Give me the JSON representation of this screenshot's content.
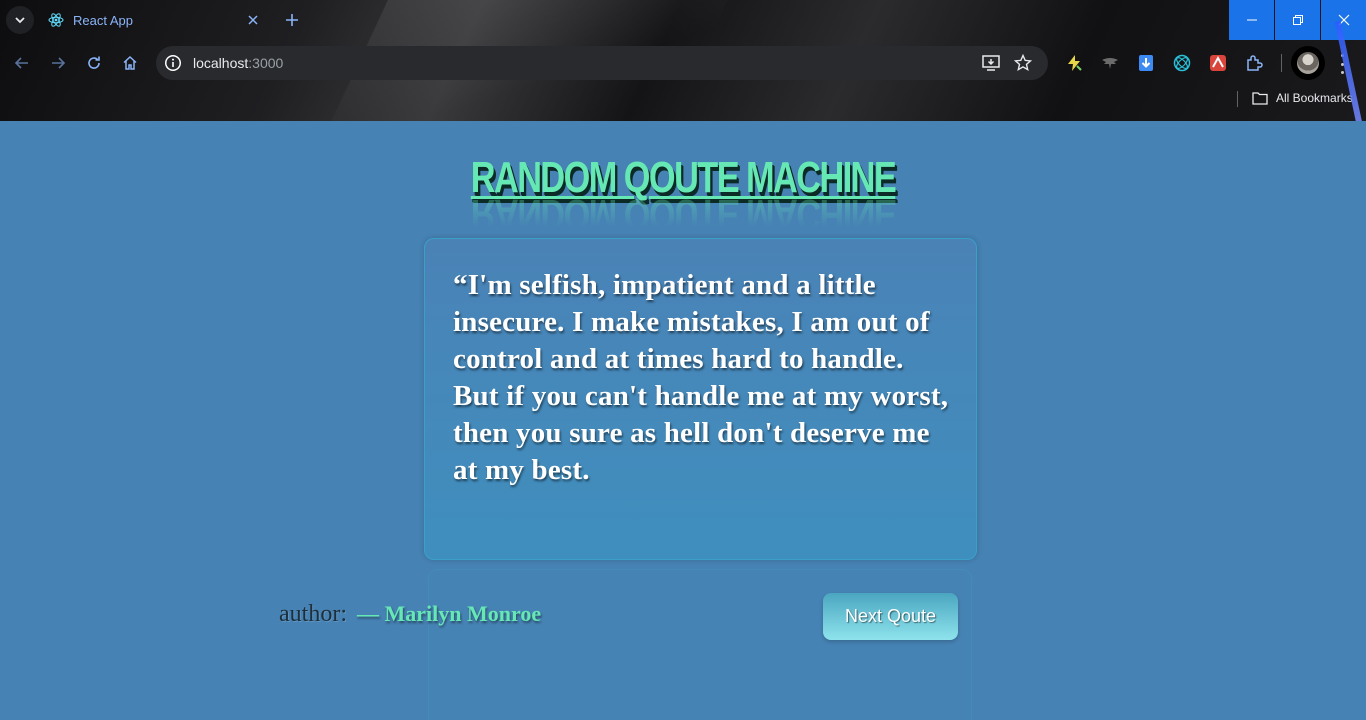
{
  "browser": {
    "tab": {
      "title": "React App"
    },
    "address": {
      "host": "localhost",
      "port": ":3000"
    },
    "bookmarks_label": "All Bookmarks"
  },
  "app": {
    "title": "RANDOM QOUTE MACHINE",
    "quote": "“I'm selfish, impatient and a little insecure. I make mistakes, I am out of control and at times hard to handle. But if you can't handle me at my worst, then you sure as hell don't deserve me at my best.",
    "author_label": "author:",
    "author_name": "— Marilyn Monroe",
    "next_button": "Next Qoute"
  },
  "colors": {
    "page_background": "#4682b4",
    "title_accent": "#66e8b5",
    "window_controls": "#1a73e8"
  }
}
